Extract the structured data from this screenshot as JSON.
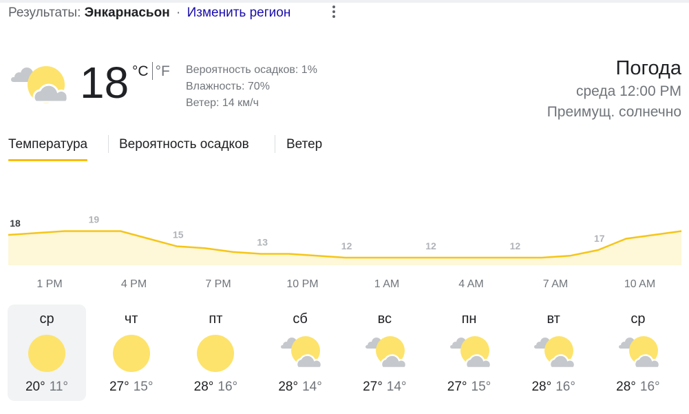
{
  "header": {
    "results_label": "Результаты:",
    "location": "Энкарнасьон",
    "separator": "·",
    "change_region": "Изменить регион"
  },
  "current": {
    "icon": "partly-sunny-icon",
    "temperature": "18",
    "unit_c": "°C",
    "unit_f": "°F",
    "precipitation": "Вероятность осадков: 1%",
    "humidity": "Влажность: 70%",
    "wind": "Ветер: 14 км/ч",
    "title": "Погода",
    "datetime": "среда 12:00 PM",
    "condition": "Преимущ. солнечно"
  },
  "tabs": [
    {
      "label": "Температура",
      "active": true
    },
    {
      "label": "Вероятность осадков",
      "active": false
    },
    {
      "label": "Ветер",
      "active": false
    }
  ],
  "colors": {
    "accent": "#fbbc04",
    "chart_line": "#f5c518",
    "chart_fill": "#fef7d8",
    "sun": "#fde36b",
    "cloud": "#c5c8cc"
  },
  "chart_data": {
    "type": "area",
    "x": [
      "12 PM",
      "1 PM",
      "2 PM",
      "3 PM",
      "4 PM",
      "5 PM",
      "6 PM",
      "7 PM",
      "8 PM",
      "9 PM",
      "10 PM",
      "11 PM",
      "12 AM",
      "1 AM",
      "2 AM",
      "3 AM",
      "4 AM",
      "5 AM",
      "6 AM",
      "7 AM",
      "8 AM",
      "9 AM",
      "10 AM",
      "11 AM"
    ],
    "values": [
      18,
      18.5,
      19,
      19,
      19,
      17,
      15,
      14.5,
      13.5,
      13,
      13,
      12.5,
      12,
      12,
      12,
      12,
      12,
      12,
      12,
      12,
      12.5,
      14,
      17,
      19
    ],
    "labels": [
      {
        "index": 0,
        "text": "18"
      },
      {
        "index": 3,
        "text": "19"
      },
      {
        "index": 6,
        "text": "15"
      },
      {
        "index": 9,
        "text": "13"
      },
      {
        "index": 12,
        "text": "12"
      },
      {
        "index": 15,
        "text": "12"
      },
      {
        "index": 18,
        "text": "12"
      },
      {
        "index": 21,
        "text": "17"
      }
    ],
    "x_ticks": [
      "1 PM",
      "4 PM",
      "7 PM",
      "10 PM",
      "1 AM",
      "4 AM",
      "7 AM",
      "10 AM"
    ]
  },
  "days": [
    {
      "name": "ср",
      "icon": "sunny-icon",
      "hi": "20°",
      "lo": "11°",
      "selected": true
    },
    {
      "name": "чт",
      "icon": "sunny-icon",
      "hi": "27°",
      "lo": "15°",
      "selected": false
    },
    {
      "name": "пт",
      "icon": "sunny-icon",
      "hi": "28°",
      "lo": "16°",
      "selected": false
    },
    {
      "name": "сб",
      "icon": "partly-sunny-icon",
      "hi": "28°",
      "lo": "14°",
      "selected": false
    },
    {
      "name": "вс",
      "icon": "partly-sunny-icon",
      "hi": "27°",
      "lo": "14°",
      "selected": false
    },
    {
      "name": "пн",
      "icon": "partly-sunny-icon",
      "hi": "27°",
      "lo": "15°",
      "selected": false
    },
    {
      "name": "вт",
      "icon": "partly-sunny-icon",
      "hi": "28°",
      "lo": "16°",
      "selected": false
    },
    {
      "name": "ср",
      "icon": "partly-sunny-icon",
      "hi": "28°",
      "lo": "16°",
      "selected": false
    }
  ]
}
